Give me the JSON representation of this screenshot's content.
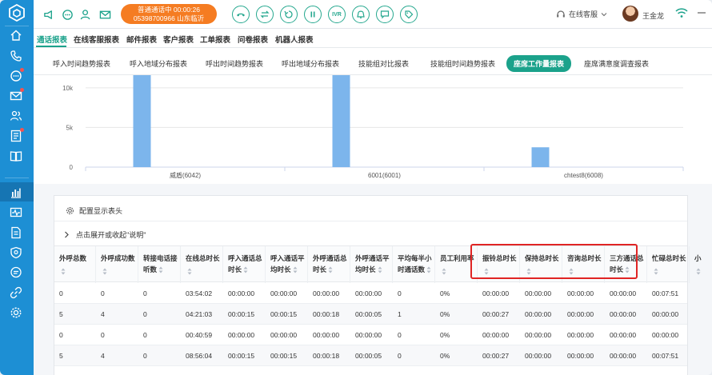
{
  "sidebar": {
    "items": [
      {
        "icon": "home-icon",
        "dot": false
      },
      {
        "icon": "phone-icon",
        "dot": false
      },
      {
        "icon": "chat-icon",
        "dot": true
      },
      {
        "icon": "mail-icon",
        "dot": true
      },
      {
        "icon": "contacts-icon",
        "dot": false
      },
      {
        "icon": "ticket-icon",
        "dot": true
      },
      {
        "icon": "book-icon",
        "dot": false
      },
      {
        "icon": "report-chart-icon",
        "dot": false,
        "active": true
      },
      {
        "icon": "monitor-icon",
        "dot": false
      },
      {
        "icon": "document-icon",
        "dot": false
      },
      {
        "icon": "shield-icon",
        "dot": false
      },
      {
        "icon": "message-icon",
        "dot": false
      },
      {
        "icon": "link-icon",
        "dot": false
      },
      {
        "icon": "gear-icon",
        "dot": false
      }
    ]
  },
  "topbar": {
    "call_status": "普通通话中 00:00:26",
    "call_number": "05398700966 山东临沂",
    "call_controls": [
      "hangup",
      "transfer",
      "consult",
      "pause",
      "IVR",
      "mute",
      "message",
      "tag"
    ],
    "ivr_label": "IVR",
    "agent_status": "在线客服",
    "user_name": "王金龙",
    "accent": "#1ba28b",
    "call_color": "#f57c22"
  },
  "main_tabs": [
    "通话报表",
    "在线客服报表",
    "邮件报表",
    "客户报表",
    "工单报表",
    "问卷报表",
    "机器人报表"
  ],
  "sub_tabs": [
    "呼入时间趋势报表",
    "呼入地域分布报表",
    "呼出时间趋势报表",
    "呼出地域分布报表",
    "技能组对比报表",
    "技能组时间趋势报表",
    "座席工作量报表",
    "座席满意度调查报表"
  ],
  "chart_data": {
    "type": "bar",
    "categories": [
      "威盾(6042)",
      "6001(6001)",
      "chtest8(6008)"
    ],
    "series": [
      {
        "values": [
          12000,
          12000,
          2500
        ]
      },
      {
        "values": [
          0,
          0,
          0
        ]
      }
    ],
    "ylim": [
      0,
      12000
    ],
    "yticks": [
      "0",
      "5k",
      "10k"
    ],
    "bar_color": "#7cb5ec",
    "grid": true
  },
  "table": {
    "config_label": "配置显示表头",
    "expand_label": "点击展开或收起\"说明\"",
    "headers": [
      [
        "外呼总数"
      ],
      [
        "外呼成功数"
      ],
      [
        "转接电话接",
        "听数"
      ],
      [
        "在线总时长"
      ],
      [
        "呼入通话总",
        "时长"
      ],
      [
        "呼入通话平",
        "均时长"
      ],
      [
        "外呼通话总",
        "时长"
      ],
      [
        "外呼通话平",
        "均时长"
      ],
      [
        "平均每半小",
        "时通话数"
      ],
      [
        "员工利用率"
      ],
      [
        "振铃总时长"
      ],
      [
        "保持总时长"
      ],
      [
        "咨询总时长"
      ],
      [
        "三方通话总",
        "时长"
      ],
      [
        "忙碌总时长"
      ],
      [
        "小"
      ]
    ],
    "rows": [
      [
        "0",
        "0",
        "0",
        "03:54:02",
        "00:00:00",
        "00:00:00",
        "00:00:00",
        "00:00:00",
        "0",
        "0%",
        "00:00:00",
        "00:00:00",
        "00:00:00",
        "00:00:00",
        "00:07:51",
        ""
      ],
      [
        "5",
        "4",
        "0",
        "04:21:03",
        "00:00:15",
        "00:00:15",
        "00:00:18",
        "00:00:05",
        "1",
        "0%",
        "00:00:27",
        "00:00:00",
        "00:00:00",
        "00:00:00",
        "00:00:00",
        ""
      ],
      [
        "0",
        "0",
        "0",
        "00:40:59",
        "00:00:00",
        "00:00:00",
        "00:00:00",
        "00:00:00",
        "0",
        "0%",
        "00:00:00",
        "00:00:00",
        "00:00:00",
        "00:00:00",
        "00:00:00",
        ""
      ],
      [
        "5",
        "4",
        "0",
        "08:56:04",
        "00:00:15",
        "00:00:15",
        "00:00:18",
        "00:00:05",
        "0",
        "0%",
        "00:00:27",
        "00:00:00",
        "00:00:00",
        "00:00:00",
        "00:07:51",
        ""
      ]
    ],
    "highlight_color": "#e02424"
  }
}
